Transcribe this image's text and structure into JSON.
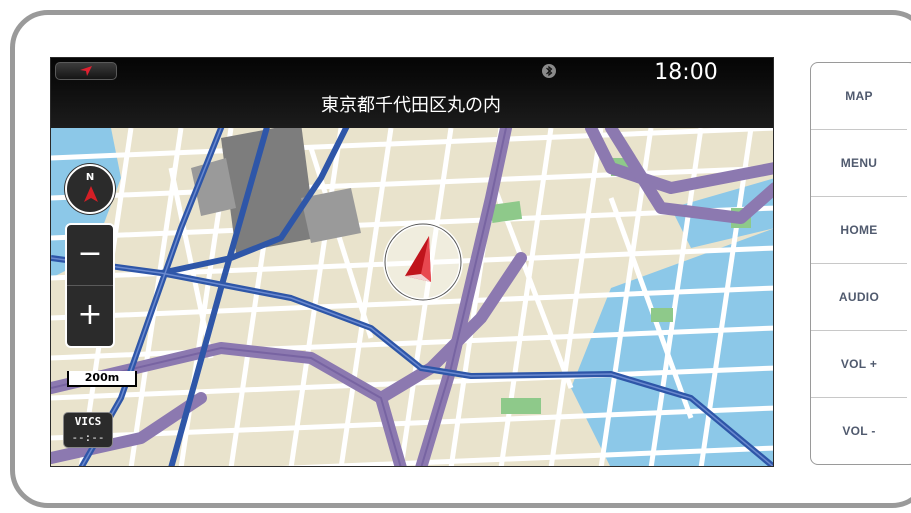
{
  "status_bar": {
    "time": "18:00",
    "address": "東京都千代田区丸の内"
  },
  "map_controls": {
    "compass_label": "N",
    "zoom_out_label": "−",
    "zoom_in_label": "+",
    "scale_label": "200m",
    "vics_label": "VICS",
    "vics_time": "--:--"
  },
  "side_buttons": [
    {
      "label": "MAP"
    },
    {
      "label": "MENU"
    },
    {
      "label": "HOME"
    },
    {
      "label": "AUDIO"
    },
    {
      "label": "VOL +"
    },
    {
      "label": "VOL -"
    }
  ],
  "colors": {
    "land": "#e9e3cc",
    "water": "#8cc8e8",
    "major_road": "#8c79b0",
    "highway": "#2e56a8",
    "park": "#8ec98a",
    "building": "#7d7d7d",
    "marker_red": "#c0141c"
  }
}
